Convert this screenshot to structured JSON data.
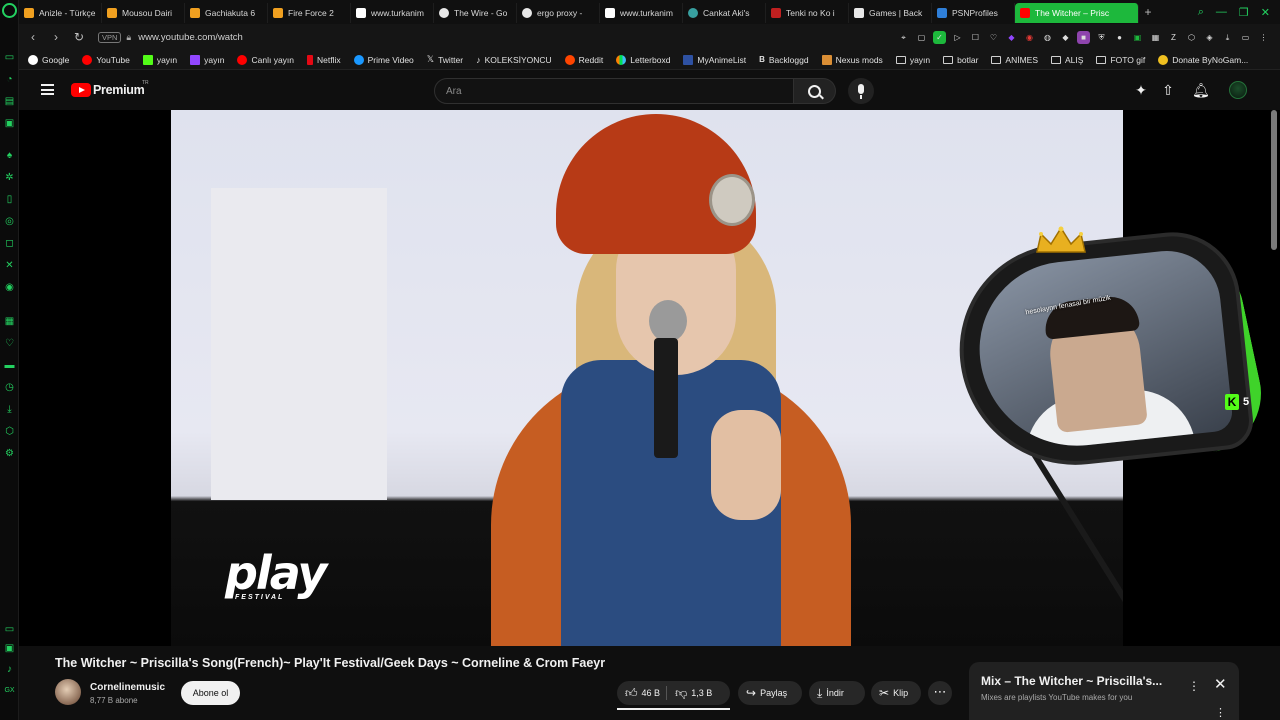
{
  "browser": {
    "tabs": [
      {
        "label": "Anizle - Türkçe",
        "color": "#f0a020"
      },
      {
        "label": "Mousou Dairi",
        "color": "#f0a020"
      },
      {
        "label": "Gachiakuta 6",
        "color": "#f0a020"
      },
      {
        "label": "Fire Force 2",
        "color": "#f0a020"
      },
      {
        "label": "www.turkanim",
        "color": "#ffffff"
      },
      {
        "label": "The Wire - Go",
        "color": "#e8e8e8"
      },
      {
        "label": "ergo proxy - ",
        "color": "#e8e8e8"
      },
      {
        "label": "www.turkanim",
        "color": "#ffffff"
      },
      {
        "label": "Cankat Aki's",
        "color": "#38a0a0"
      },
      {
        "label": "Tenki no Ko i",
        "color": "#c02020"
      },
      {
        "label": "Games | Back",
        "color": "#e8e8e8"
      },
      {
        "label": "PSNProfiles",
        "color": "#2f7fd8"
      }
    ],
    "active_tab": "The Witcher – Prisc",
    "new_tab": "+",
    "url": "www.youtube.com/watch",
    "vpn_label": "VPN",
    "bookmarks": [
      {
        "label": "Google",
        "color": "#ffffff"
      },
      {
        "label": "YouTube",
        "color": "#ff0000"
      },
      {
        "label": "yayın",
        "color": "#53fc18"
      },
      {
        "label": "yayın",
        "color": "#9146ff"
      },
      {
        "label": "Canlı yayın",
        "color": "#ff0000"
      },
      {
        "label": "Netflix",
        "color": "#e50914"
      },
      {
        "label": "Prime Video",
        "color": "#1a98ff"
      },
      {
        "label": "Twitter",
        "color": "#ffffff"
      },
      {
        "label": "KOLEKSİYONCU",
        "color": "#ffffff"
      },
      {
        "label": "Reddit",
        "color": "#ff4500"
      },
      {
        "label": "Letterboxd",
        "color": "#40bcf4"
      },
      {
        "label": "MyAnimeList",
        "color": "#2e51a2"
      },
      {
        "label": "Backloggd",
        "color": "#ffffff"
      },
      {
        "label": "Nexus mods",
        "color": "#da8e35"
      }
    ],
    "folders": [
      "yayın",
      "botlar",
      "ANİMES",
      "ALIŞ",
      "FOTO gif",
      "Donate ByNoGam..."
    ]
  },
  "youtube": {
    "brand": "Premium",
    "country": "TR",
    "search_placeholder": "Ara"
  },
  "video": {
    "overlay_logo": "play",
    "overlay_logo_sub": "FESTIVAL",
    "title": "The Witcher ~ Priscilla's Song(French)~ Play'It Festival/Geek Days ~ Corneline & Crom Faeyr",
    "channel": "Cornelinemusic",
    "subscribers": "8,77 B abone",
    "subscribe_label": "Abone ol",
    "likes": "46 B",
    "dislikes": "1,3 B",
    "share_label": "Paylaş",
    "download_label": "İndir",
    "clip_label": "Klip"
  },
  "stream_overlay": {
    "cam_text": "hesolaynn fenasal bir müzik",
    "kick_count": "5"
  },
  "mix": {
    "title": "Mix – The Witcher ~ Priscilla's...",
    "subtitle": "Mixes are playlists YouTube makes for you"
  },
  "colors": {
    "accent_opera": "#1db83c",
    "yt_red": "#ff0000",
    "kick_green": "#53fc18"
  }
}
